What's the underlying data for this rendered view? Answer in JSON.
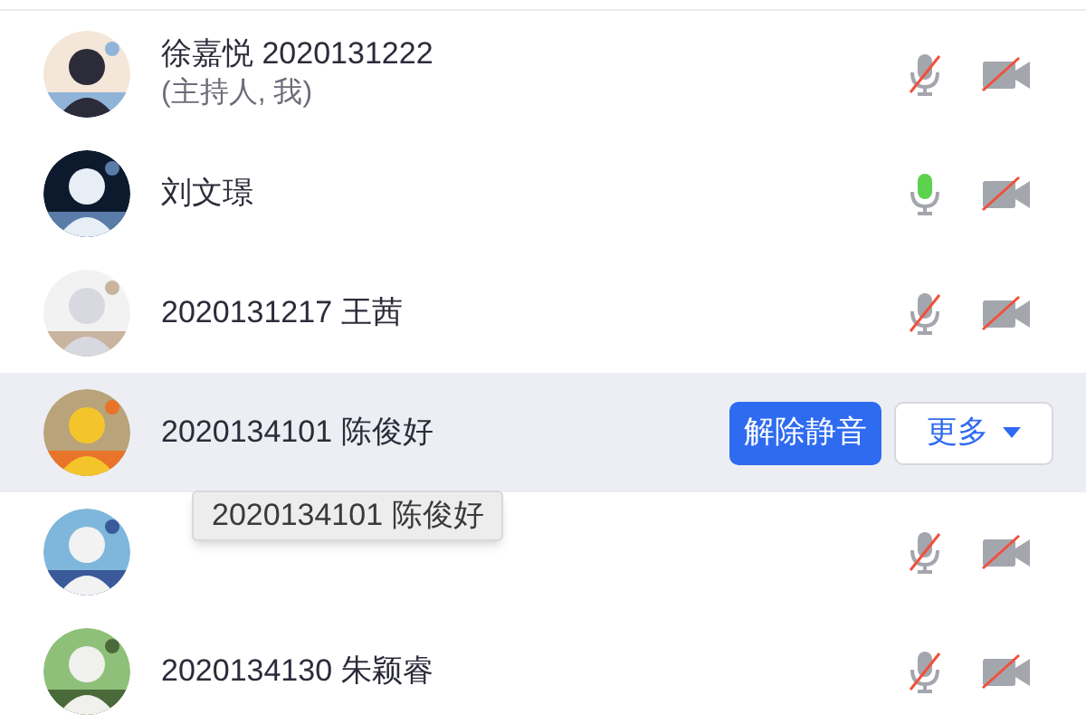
{
  "participants": [
    {
      "name": "徐嘉悦 2020131222",
      "note": "(主持人, 我)",
      "mic_muted": true,
      "camera_off": true,
      "selected": false
    },
    {
      "name": "刘文璟",
      "mic_muted": false,
      "camera_off": true,
      "selected": false
    },
    {
      "name": "2020131217 王茜",
      "mic_muted": true,
      "camera_off": true,
      "selected": false
    },
    {
      "name": "2020134101 陈俊好",
      "selected": true,
      "actions": {
        "primary": "解除静音",
        "more": "更多"
      }
    },
    {
      "mic_muted": true,
      "camera_off": true,
      "selected": false
    },
    {
      "name": "2020134130 朱颖睿",
      "mic_muted": true,
      "camera_off": true,
      "selected": false
    }
  ],
  "tooltip": {
    "text": "2020134101 陈俊好"
  }
}
